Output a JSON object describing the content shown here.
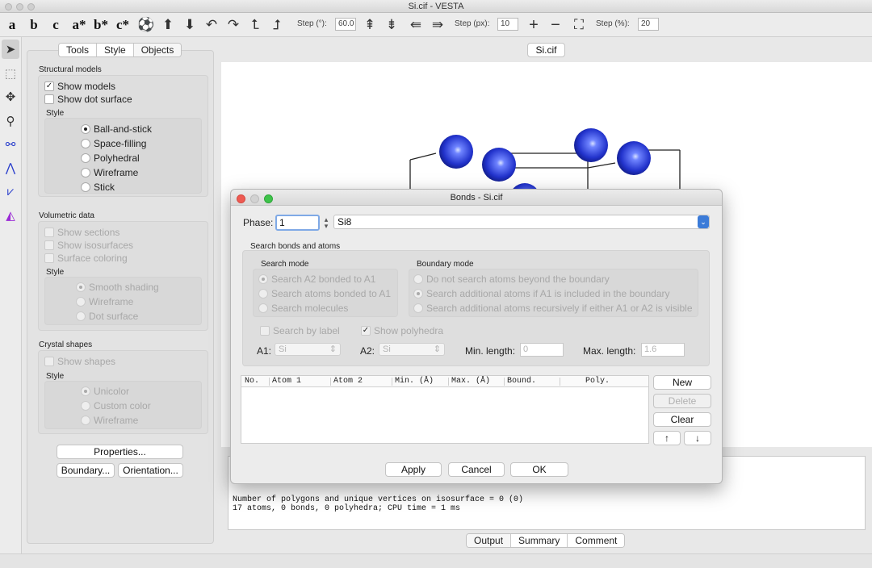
{
  "window": {
    "title": "Si.cif - VESTA"
  },
  "toolbar": {
    "axes": [
      "a",
      "b",
      "c",
      "a*",
      "b*",
      "c*"
    ],
    "step_deg_label": "Step (°):",
    "step_deg_value": "60.0",
    "step_px_label": "Step (px):",
    "step_px_value": "10",
    "step_pct_label": "Step (%):",
    "step_pct_value": "20"
  },
  "panel": {
    "tabs": [
      "Tools",
      "Style",
      "Objects"
    ],
    "structural": {
      "title": "Structural models",
      "show_models": "Show models",
      "show_dot_surface": "Show dot surface",
      "style_label": "Style",
      "styles": [
        "Ball-and-stick",
        "Space-filling",
        "Polyhedral",
        "Wireframe",
        "Stick"
      ],
      "selected_style": "Ball-and-stick"
    },
    "volumetric": {
      "title": "Volumetric data",
      "show_sections": "Show sections",
      "show_isosurfaces": "Show isosurfaces",
      "surface_coloring": "Surface coloring",
      "style_label": "Style",
      "styles": [
        "Smooth shading",
        "Wireframe",
        "Dot surface"
      ]
    },
    "crystal": {
      "title": "Crystal shapes",
      "show_shapes": "Show shapes",
      "style_label": "Style",
      "styles": [
        "Unicolor",
        "Custom color",
        "Wireframe"
      ]
    },
    "properties_button": "Properties...",
    "boundary_button": "Boundary...",
    "orientation_button": "Orientation..."
  },
  "document_tab": "Si.cif",
  "console": {
    "lines": [
      "Number of polygons and unique vertices on isosurface = 0 (0)",
      "17 atoms, 0 bonds, 0 polyhedra; CPU time = 1 ms"
    ]
  },
  "bottom_tabs": [
    "Output",
    "Summary",
    "Comment"
  ],
  "colors": {
    "atom": "#2233cc",
    "accent": "#3b7bd8"
  },
  "dialog": {
    "title": "Bonds - Si.cif",
    "phase_label": "Phase:",
    "phase_value": "1",
    "phase_name": "Si8",
    "search_title": "Search bonds and atoms",
    "search_mode_title": "Search mode",
    "search_modes": [
      "Search A2 bonded to A1",
      "Search atoms bonded to A1",
      "Search molecules"
    ],
    "boundary_mode_title": "Boundary mode",
    "boundary_modes": [
      "Do not search atoms beyond the boundary",
      "Search additional atoms if A1 is included in the boundary",
      "Search additional atoms recursively if either A1 or A2 is visible"
    ],
    "search_by_label": "Search by label",
    "show_polyhedra": "Show polyhedra",
    "a1_label": "A1:",
    "a1_value": "Si",
    "a2_label": "A2:",
    "a2_value": "Si",
    "min_label": "Min. length:",
    "min_value": "0",
    "max_label": "Max. length:",
    "max_value": "1.6",
    "columns": [
      "No.",
      "Atom 1",
      "Atom 2",
      "Min. (Å)",
      "Max. (Å)",
      "Bound.",
      "Poly."
    ],
    "new_button": "New",
    "delete_button": "Delete",
    "clear_button": "Clear",
    "up_button": "↑",
    "down_button": "↓",
    "apply_button": "Apply",
    "cancel_button": "Cancel",
    "ok_button": "OK"
  }
}
